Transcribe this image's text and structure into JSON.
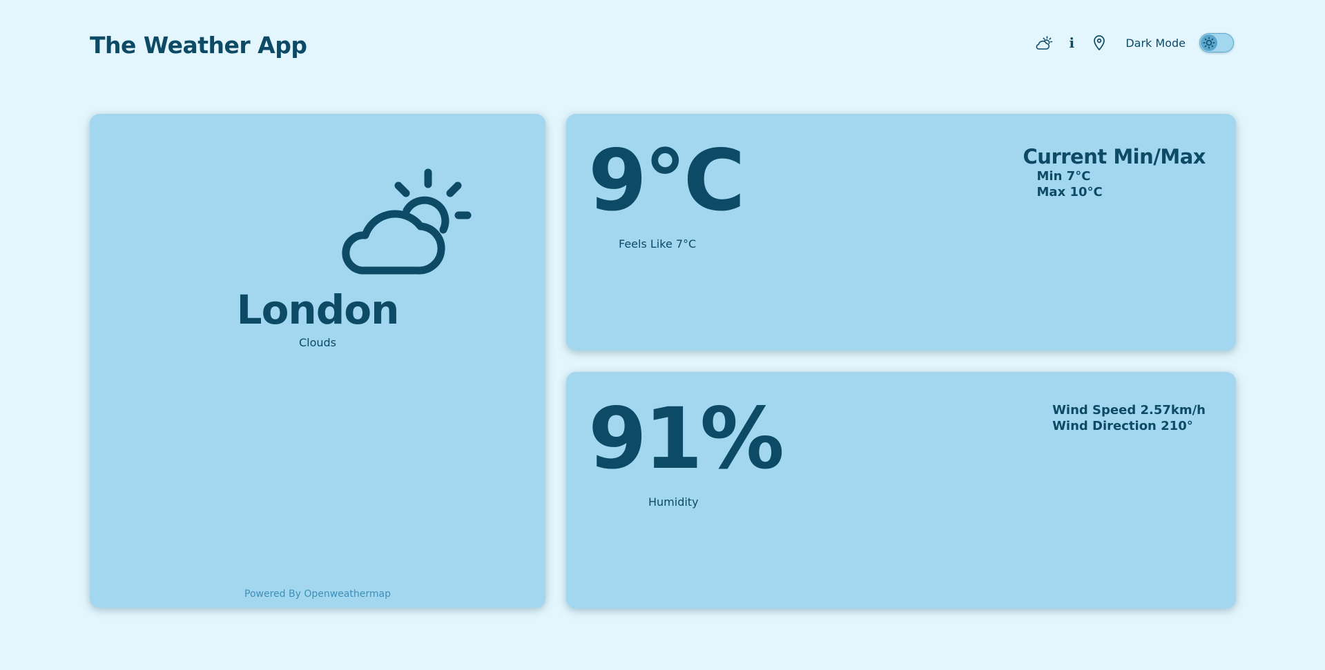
{
  "header": {
    "title": "The Weather App",
    "dark_mode_label": "Dark Mode",
    "info_glyph": "i"
  },
  "icons": {
    "header_weather": "cloud-sun-icon",
    "header_info": "info-icon",
    "header_location": "location-pin-icon",
    "toggle_knob": "sun-icon",
    "main_weather": "cloud-sun-icon"
  },
  "location_card": {
    "city": "London",
    "condition": "Clouds",
    "powered_by": "Powered By Openweathermap"
  },
  "temperature_card": {
    "temperature": "9°C",
    "feels_like": "Feels Like 7°C",
    "minmax_title": "Current Min/Max",
    "min": "Min 7°C",
    "max": "Max 10°C"
  },
  "humidity_card": {
    "humidity": "91%",
    "humidity_label": "Humidity",
    "wind_speed": "Wind Speed 2.57km/h",
    "wind_direction": "Wind Direction 210°"
  },
  "colors": {
    "page_background": "#e3f6fd",
    "card_background": "#a3d7ef",
    "text_primary": "#0d4a66",
    "link": "#3d8fb8",
    "toggle_knob": "#5aa6cc"
  },
  "toggle": {
    "dark_mode_on": false
  }
}
